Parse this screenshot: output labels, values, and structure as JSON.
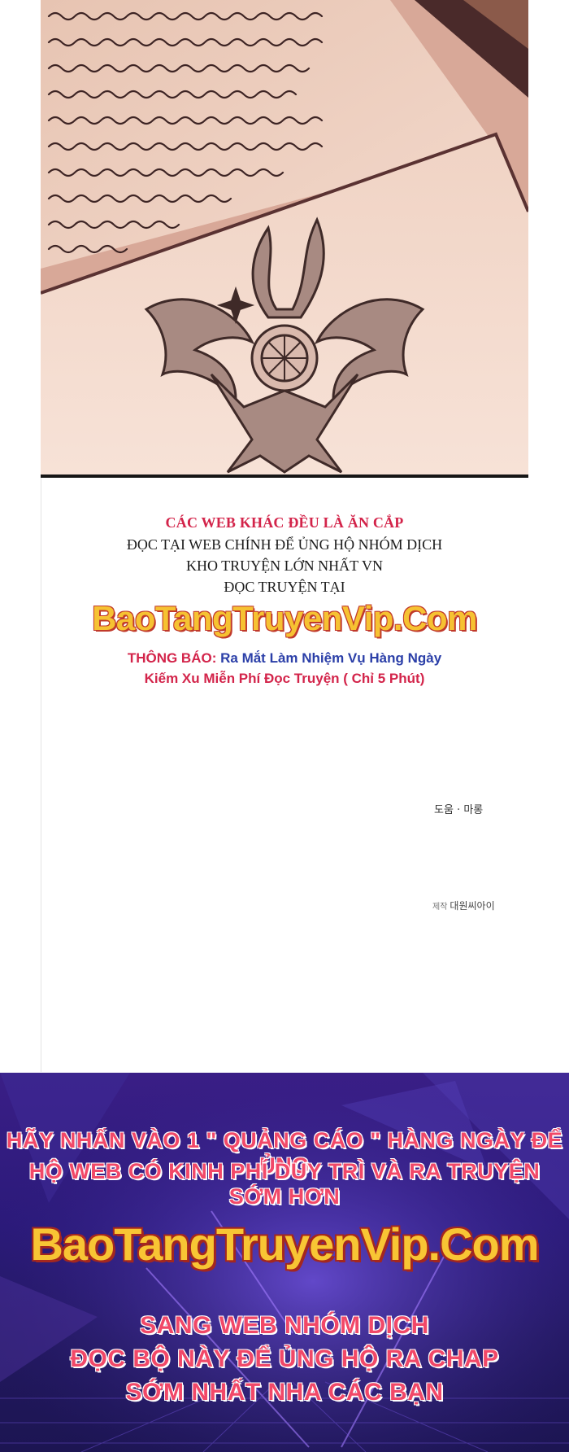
{
  "notice": {
    "line1": "CÁC WEB KHÁC ĐỀU LÀ ĂN CẮP",
    "line2": "ĐỌC TẠI WEB CHÍNH ĐỂ ỦNG HỘ NHÓM DỊCH",
    "line3": "KHO TRUYỆN LỚN NHẤT VN",
    "line4": "ĐỌC TRUYỆN TẠI",
    "site": "BaoTangTruyenVip.Com",
    "announce_label": "THÔNG BÁO:",
    "announce_text": "Ra Mắt Làm Nhiệm Vụ Hàng Ngày",
    "announce_line2": "Kiếm Xu Miễn Phí Đọc Truyện ( Chỉ 5 Phút)"
  },
  "credits": {
    "line1": "도움 · 마롱",
    "line2_prefix": "제작",
    "line2": "대원씨아이"
  },
  "banner": {
    "line1": "HÃY NHẤN VÀO 1 \" QUẢNG CÁO \" HÀNG NGÀY ĐỂ ỦNG",
    "line2": "HỘ WEB CÓ KINH PHÍ DUY TRÌ VÀ RA TRUYỆN SỚM HƠN",
    "site": "BaoTangTruyenVip.Com",
    "line3": "SANG WEB NHÓM DỊCH",
    "line4": "ĐỌC BỘ NÀY ĐỂ ỦNG HỘ RA CHAP",
    "line5": "SỚM NHẤT NHA CÁC BẠN"
  },
  "colors": {
    "accent_red": "#d3244a",
    "accent_blue": "#2b3fa8",
    "site_yellow": "#f6c232",
    "banner_purple": "#2b1a7a"
  },
  "icons": [
    "emblem-seal-icon",
    "compass-star-icon"
  ]
}
